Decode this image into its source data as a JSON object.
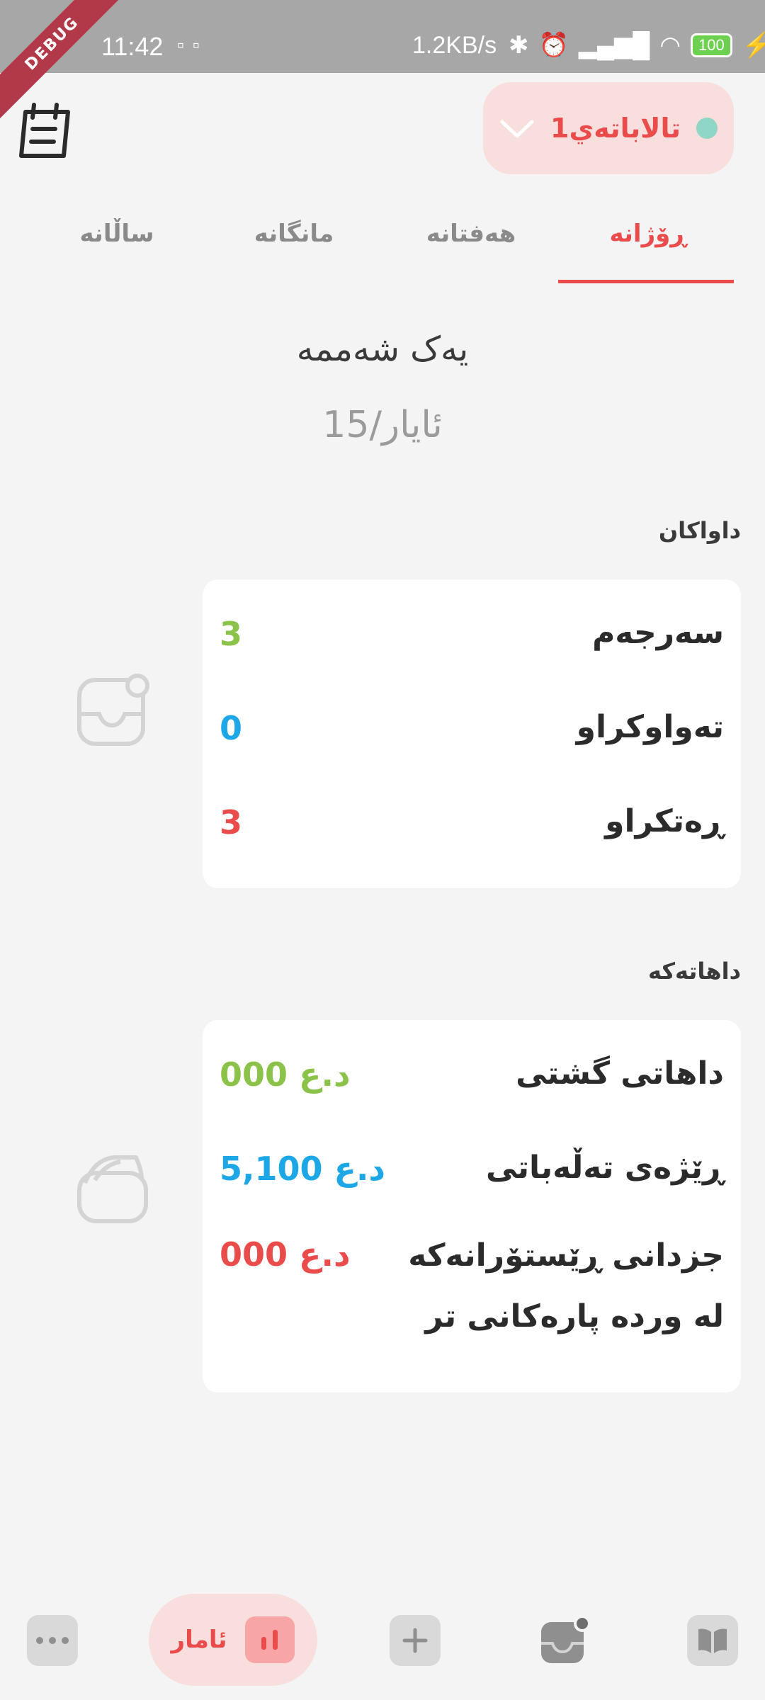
{
  "status_bar": {
    "time": "11:42",
    "speed": "1.2KB/s",
    "battery": "100"
  },
  "debug_banner": "DEBUG",
  "header": {
    "branch_name": "تالاباتەي1"
  },
  "tabs": [
    {
      "label": "ڕۆژانە",
      "active": true
    },
    {
      "label": "هەفتانە",
      "active": false
    },
    {
      "label": "مانگانە",
      "active": false
    },
    {
      "label": "ساڵانە",
      "active": false
    }
  ],
  "date": {
    "day_name": "یەک شەممە",
    "date": "15/ئایار"
  },
  "orders": {
    "title": "داواکان",
    "rows": [
      {
        "label": "سەرجەم",
        "value": "3",
        "color": "#8bc34a"
      },
      {
        "label": "تەواوکراو",
        "value": "0",
        "color": "#1ea7e6"
      },
      {
        "label": "ڕەتکراو",
        "value": "3",
        "color": "#ea4b4b"
      }
    ]
  },
  "income": {
    "title": "داهاتەکە",
    "rows": [
      {
        "label": "داهاتی گشتی",
        "value": "000 د.ع",
        "color": "#8bc34a"
      },
      {
        "label": "ڕێژەی تەڵەباتی",
        "value": "5,100 د.ع",
        "color": "#1ea7e6"
      },
      {
        "label": "جزدانی ڕێستۆرانەکە لە وردە پارەکانی تر",
        "value": "000 د.ع",
        "color": "#ea4b4b"
      }
    ]
  },
  "bottom_nav": {
    "stats_label": "ئامار"
  },
  "icons": {
    "calendar": "calendar-notes-icon",
    "chevron": "chevron-down-icon",
    "orders": "inbox-icon",
    "income": "wallet-icon",
    "more": "more-dots-icon",
    "stats": "bar-chart-icon",
    "add": "plus-icon",
    "inbox_nav": "inbox-icon",
    "menu": "book-icon"
  }
}
